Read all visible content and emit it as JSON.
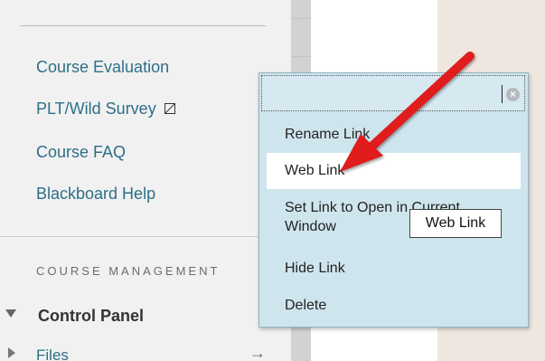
{
  "course_menu": {
    "links": [
      {
        "label": "Course Evaluation"
      },
      {
        "label": "PLT/Wild Survey",
        "external_icon": "external-link-icon"
      },
      {
        "label": "Course FAQ"
      },
      {
        "label": "Blackboard Help"
      }
    ],
    "section_heading": "COURSE MANAGEMENT",
    "control_panel": {
      "label": "Control Panel",
      "icon": "caret-down-icon"
    },
    "files": {
      "label": "Files",
      "icon": "caret-right-icon",
      "go_icon": "→"
    }
  },
  "context_menu": {
    "clear_icon": "clear-icon",
    "items": [
      {
        "label": "Rename Link"
      },
      {
        "label": "Web Link",
        "highlighted": true
      },
      {
        "label": "Set Link to Open in Current Window"
      },
      {
        "label": "Hide Link"
      },
      {
        "label": "Delete"
      }
    ]
  },
  "tooltip": {
    "text": "Web Link"
  },
  "annotation": {
    "icon": "red-arrow-icon",
    "color": "#e01b1b"
  },
  "colors": {
    "link": "#2e6f88",
    "menu_bg": "#cfe5ee",
    "panel_bg": "#f1f1f1",
    "highlight": "#ffffff"
  }
}
